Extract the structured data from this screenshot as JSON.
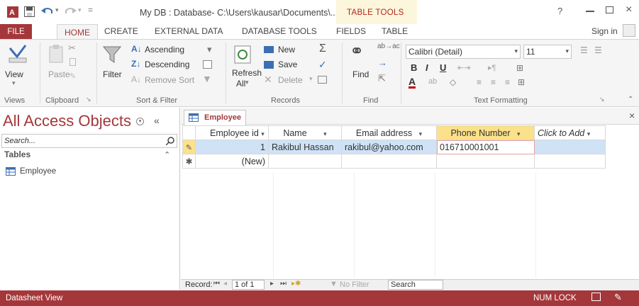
{
  "window": {
    "title": "My DB : Database- C:\\Users\\kausar\\Documents\\...",
    "context_tab_group": "TABLE TOOLS",
    "help_glyph": "?",
    "sign_in": "Sign in"
  },
  "ribbon_tabs": [
    "FILE",
    "HOME",
    "CREATE",
    "EXTERNAL DATA",
    "DATABASE TOOLS",
    "FIELDS",
    "TABLE"
  ],
  "ribbon": {
    "views": {
      "view_label": "View",
      "group": "Views"
    },
    "clipboard": {
      "paste_label": "Paste",
      "group": "Clipboard"
    },
    "sort_filter": {
      "filter_label": "Filter",
      "ascending": "Ascending",
      "descending": "Descending",
      "remove_sort": "Remove Sort",
      "group": "Sort & Filter"
    },
    "records": {
      "refresh_label": "Refresh",
      "refresh_all": "All",
      "new": "New",
      "save": "Save",
      "delete": "Delete",
      "group": "Records"
    },
    "find": {
      "find_label": "Find",
      "group": "Find"
    },
    "text_formatting": {
      "font": "Calibri (Detail)",
      "size": "11",
      "group": "Text Formatting"
    }
  },
  "nav_pane": {
    "header": "All Access Objects",
    "search_placeholder": "Search...",
    "section": "Tables",
    "items": [
      "Employee"
    ]
  },
  "document": {
    "tab_label": "Employee",
    "columns": [
      "Employee id",
      "Name",
      "Email address",
      "Phone Number",
      "Click to Add"
    ],
    "rows": [
      {
        "id": "1",
        "name": "Rakibul Hassan",
        "email": "rakibul@yahoo.com",
        "phone": "016710001001"
      }
    ],
    "new_row_label": "(New)"
  },
  "record_nav": {
    "record_label": "Record:",
    "position": "1 of 1",
    "filter_label": "No Filter",
    "search_label": "Search"
  },
  "status_bar": {
    "left": "Datasheet View",
    "num_lock": "NUM LOCK"
  },
  "colors": {
    "accent": "#a4373a",
    "context_tab": "#fbf6dc",
    "selected_row": "#cfe2f6",
    "highlight_header": "#fbe18a"
  }
}
